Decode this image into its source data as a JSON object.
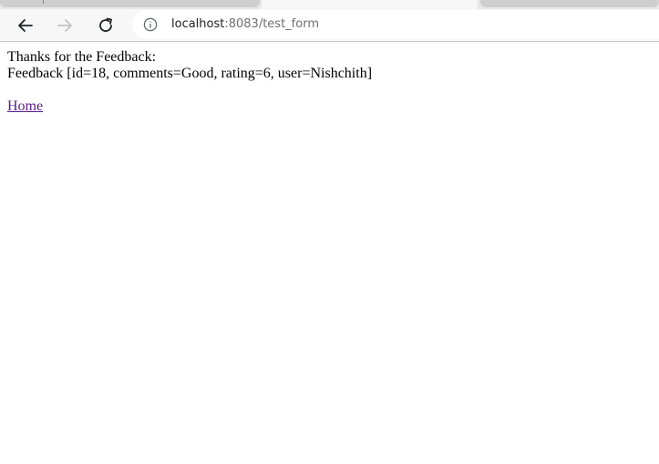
{
  "browser": {
    "address_bar": {
      "host": "localhost",
      "path": ":8083/test_form"
    }
  },
  "page": {
    "thanks_text": "Thanks for the Feedback:",
    "feedback_text": "Feedback [id=18, comments=Good, rating=6, user=Nishchith]",
    "home_link": "Home"
  },
  "icons": {
    "back": "back-arrow-icon",
    "forward": "forward-arrow-icon",
    "reload": "reload-icon",
    "info": "info-icon"
  },
  "colors": {
    "link_visited": "#551a8b",
    "url_path": "#6f6f6f",
    "toolbar_bg": "#f7f7f7"
  }
}
